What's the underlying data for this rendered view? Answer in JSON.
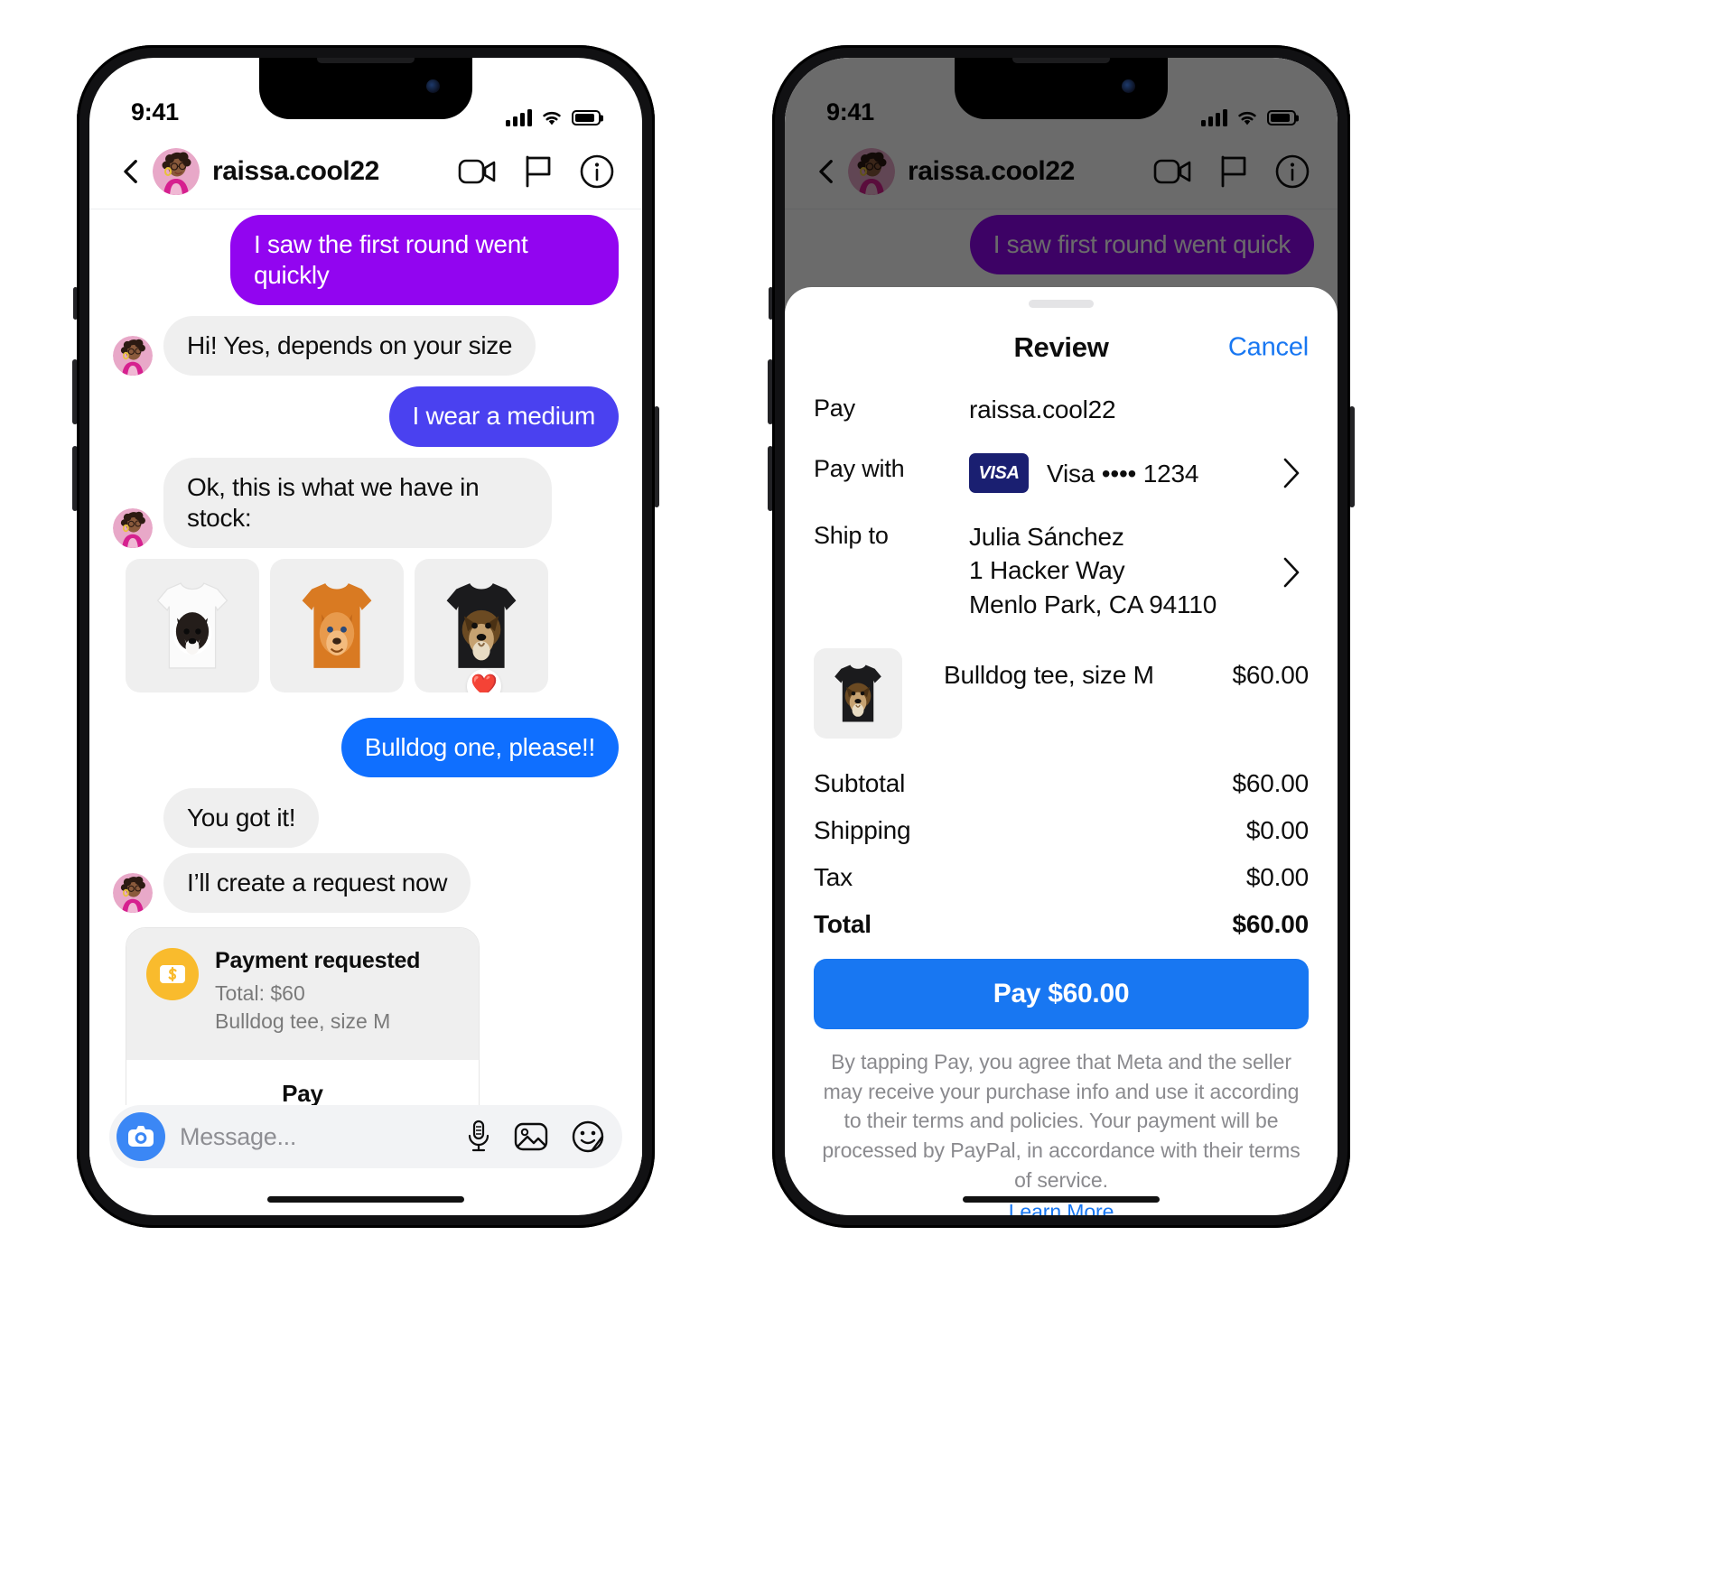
{
  "status_bar": {
    "time": "9:41",
    "signal_icon": "cellular-bars-icon",
    "wifi_icon": "wifi-icon",
    "battery_icon": "battery-icon"
  },
  "chat_header": {
    "back_icon": "back-chevron-icon",
    "username": "raissa.cool22",
    "video_icon": "video-camera-icon",
    "flag_icon": "flag-icon",
    "info_icon": "info-circle-icon"
  },
  "thread": {
    "messages": [
      {
        "id": "m0",
        "side": "out",
        "style": "purple",
        "text": "",
        "clipped": true
      },
      {
        "id": "m1",
        "side": "out",
        "style": "purple",
        "text": "I saw the first round went quickly"
      },
      {
        "id": "m2",
        "side": "in",
        "style": "gray",
        "text": "Hi! Yes, depends on your size",
        "avatar": true
      },
      {
        "id": "m3",
        "side": "out",
        "style": "indigo",
        "text": "I wear a medium"
      },
      {
        "id": "m4",
        "side": "in",
        "style": "gray",
        "text": "Ok, this is what we have in stock:",
        "avatar": true
      },
      {
        "id": "m5",
        "side": "out",
        "style": "blue",
        "text": "Bulldog one, please!!"
      },
      {
        "id": "m6",
        "side": "in",
        "style": "gray",
        "text": "You got it!",
        "avatar": false
      },
      {
        "id": "m7",
        "side": "in",
        "style": "gray",
        "text": "I’ll create a request now",
        "avatar": true
      }
    ],
    "gallery": {
      "items": [
        {
          "id": "tee-white",
          "label": "white-border-collie-tee"
        },
        {
          "id": "tee-orange",
          "label": "orange-golden-retriever-tee"
        },
        {
          "id": "tee-black",
          "label": "black-bulldog-tee"
        }
      ],
      "reaction": "❤️"
    },
    "payment_request": {
      "icon": "money-dollar-icon",
      "title": "Payment requested",
      "total_line": "Total: $60",
      "item_line": "Bulldog tee, size M",
      "button_label": "Pay"
    }
  },
  "composer": {
    "camera_icon": "camera-icon",
    "placeholder": "Message...",
    "mic_icon": "microphone-icon",
    "photo_icon": "photo-icon",
    "sticker_icon": "sticker-smiley-icon"
  },
  "right_phone": {
    "dim_message_1": "",
    "dim_message_2": "I saw first round went quick",
    "sheet": {
      "title": "Review",
      "cancel_label": "Cancel",
      "rows": [
        {
          "id": "pay",
          "label": "Pay",
          "value": "raissa.cool22",
          "chevron": false
        },
        {
          "id": "pay-with",
          "label": "Pay with",
          "brand": "VISA",
          "value": "Visa •••• 1234",
          "chevron": true
        },
        {
          "id": "ship-to",
          "label": "Ship to",
          "value": "Julia Sánchez\n1 Hacker Way\nMenlo Park, CA 94110",
          "chevron": true
        }
      ],
      "line_item": {
        "thumb": "black-bulldog-tee",
        "name": "Bulldog tee, size M",
        "price": "$60.00"
      },
      "totals": [
        {
          "label": "Subtotal",
          "value": "$60.00",
          "bold": false
        },
        {
          "label": "Shipping",
          "value": "$0.00",
          "bold": false
        },
        {
          "label": "Tax",
          "value": "$0.00",
          "bold": false
        },
        {
          "label": "Total",
          "value": "$60.00",
          "bold": true
        }
      ],
      "pay_button_label": "Pay $60.00",
      "legal_text": "By tapping Pay, you agree that Meta and the seller may receive your purchase info and use it according to their terms and policies. Your payment will be processed by PayPal, in accordance with their terms of service.",
      "legal_link": "Learn More"
    }
  },
  "colors": {
    "blue": "#0f6fff",
    "indigo": "#4a41f0",
    "purple": "#9205f0",
    "gray_bubble": "#efefef",
    "link_blue": "#1877f2",
    "coin_yellow": "#f9bb2d",
    "visa_navy": "#1a1f71"
  }
}
